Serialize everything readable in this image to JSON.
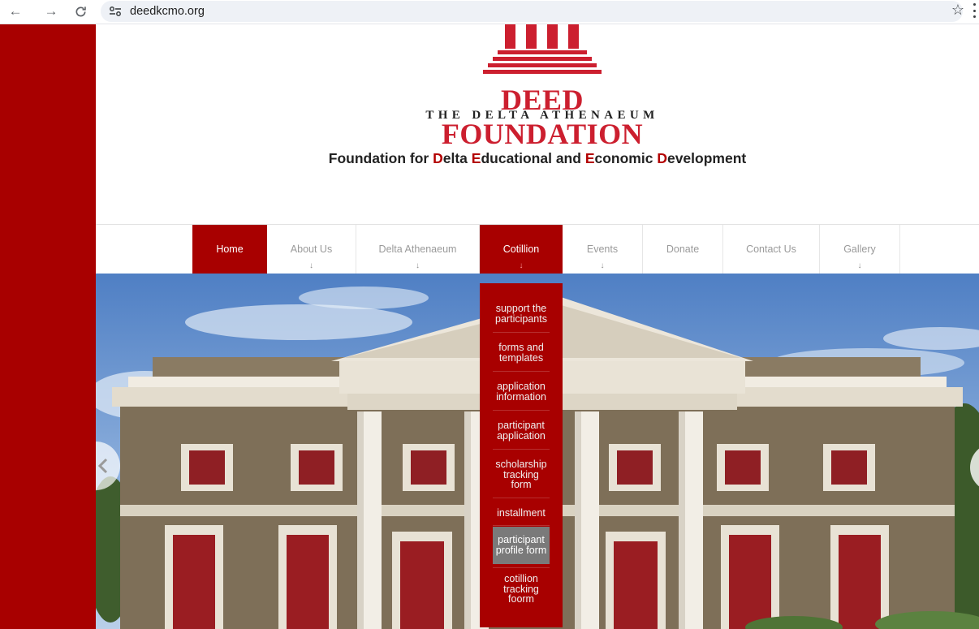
{
  "browser": {
    "url": "deedkcmo.org",
    "back_glyph": "←",
    "forward_glyph": "→",
    "reload_glyph": "⟳",
    "star_glyph": "☆"
  },
  "header": {
    "brand_name": "DEED FOUNDATION",
    "brand_subtitle": "THE DELTA ATHENAEUM",
    "tagline_parts": [
      "Foundation for ",
      "D",
      "elta ",
      "E",
      "ducational and ",
      "E",
      "conomic ",
      "D",
      "evelopment"
    ]
  },
  "nav": {
    "items": [
      {
        "label": "Home",
        "arrow": ""
      },
      {
        "label": "About Us",
        "arrow": "↓"
      },
      {
        "label": "Delta Athenaeum",
        "arrow": "↓"
      },
      {
        "label": "Cotillion",
        "arrow": "↓"
      },
      {
        "label": "Events",
        "arrow": "↓"
      },
      {
        "label": "Donate",
        "arrow": ""
      },
      {
        "label": "Contact Us",
        "arrow": ""
      },
      {
        "label": "Gallery",
        "arrow": "↓"
      }
    ]
  },
  "dropdown": {
    "items": [
      {
        "label": "support the participants"
      },
      {
        "label": "forms and templates"
      },
      {
        "label": "application information"
      },
      {
        "label": "participant application"
      },
      {
        "label": "scholarship tracking form"
      },
      {
        "label": "installment"
      },
      {
        "label": "participant profile form"
      },
      {
        "label": "cotillion tracking foorm"
      }
    ]
  },
  "colors": {
    "brand_red": "#a80000",
    "logo_red": "#cc1f2f",
    "sky": "#6f9ad2",
    "brick": "#7e6f58"
  }
}
